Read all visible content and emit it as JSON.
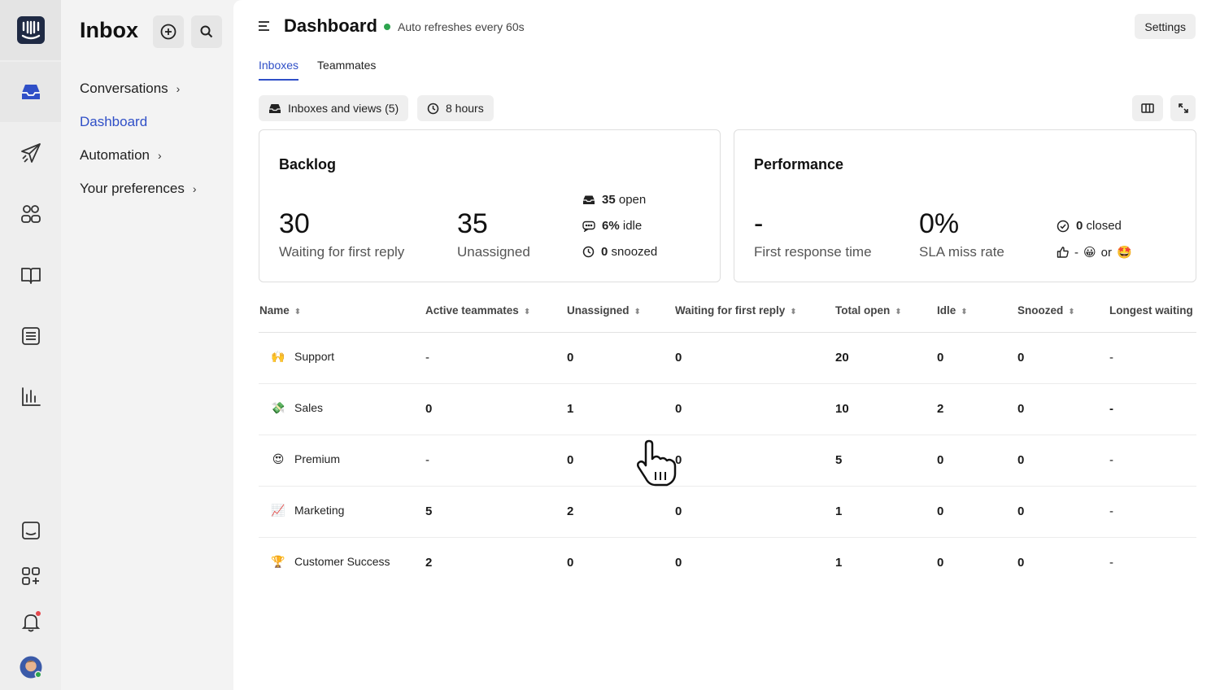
{
  "nav": {
    "title": "Inbox",
    "items": [
      {
        "label": "Conversations",
        "chevron": "›"
      },
      {
        "label": "Dashboard",
        "chevron": ""
      },
      {
        "label": "Automation",
        "chevron": "›"
      },
      {
        "label": "Your preferences",
        "chevron": "›"
      }
    ]
  },
  "header": {
    "title": "Dashboard",
    "subtitle": "Auto refreshes every 60s",
    "settings": "Settings"
  },
  "tabs": [
    "Inboxes",
    "Teammates"
  ],
  "filters": {
    "inboxes": "Inboxes and views (5)",
    "time": "8 hours"
  },
  "backlog": {
    "title": "Backlog",
    "waiting_value": "30",
    "waiting_label": "Waiting for first reply",
    "unassigned_value": "35",
    "unassigned_label": "Unassigned",
    "open_value": "35",
    "open_label": "open",
    "idle_value": "6%",
    "idle_label": "idle",
    "snoozed_value": "0",
    "snoozed_label": "snoozed"
  },
  "performance": {
    "title": "Performance",
    "frt_value": "-",
    "frt_label": "First response time",
    "sla_value": "0%",
    "sla_label": "SLA miss rate",
    "closed_value": "0",
    "closed_label": "closed",
    "csat_dash": "-",
    "csat_or": "or"
  },
  "table": {
    "headers": [
      "Name",
      "Active teammates",
      "Unassigned",
      "Waiting for first reply",
      "Total open",
      "Idle",
      "Snoozed",
      "Longest waiting"
    ],
    "rows": [
      {
        "emoji": "🙌",
        "name": "Support",
        "active": "-",
        "unassigned": "0",
        "waiting": "0",
        "total": "20",
        "idle": "0",
        "snoozed": "0",
        "longest": "-"
      },
      {
        "emoji": "💸",
        "name": "Sales",
        "active": "0",
        "unassigned": "1",
        "waiting": "0",
        "total": "10",
        "idle": "2",
        "snoozed": "0",
        "longest": "-"
      },
      {
        "emoji": "😍",
        "name": "Premium",
        "active": "-",
        "unassigned": "0",
        "waiting": "0",
        "total": "5",
        "idle": "0",
        "snoozed": "0",
        "longest": "-"
      },
      {
        "emoji": "📈",
        "name": "Marketing",
        "active": "5",
        "unassigned": "2",
        "waiting": "0",
        "total": "1",
        "idle": "0",
        "snoozed": "0",
        "longest": "-"
      },
      {
        "emoji": "🏆",
        "name": "Customer Success",
        "active": "2",
        "unassigned": "0",
        "waiting": "0",
        "total": "1",
        "idle": "0",
        "snoozed": "0",
        "longest": "-"
      }
    ]
  },
  "colors": {
    "accent": "#2f4fc7",
    "live": "#2da44e",
    "notification": "#e5484d"
  }
}
